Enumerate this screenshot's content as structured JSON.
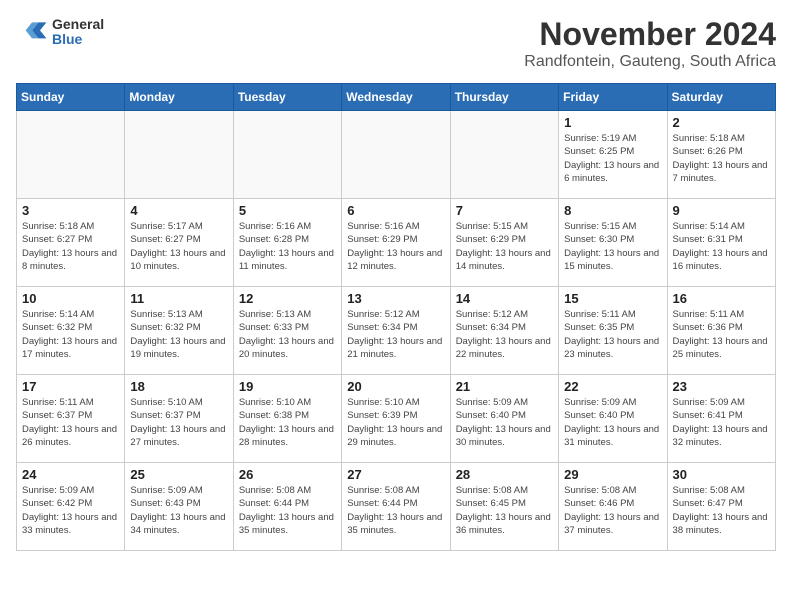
{
  "header": {
    "logo_general": "General",
    "logo_blue": "Blue",
    "month_title": "November 2024",
    "location": "Randfontein, Gauteng, South Africa"
  },
  "days_of_week": [
    "Sunday",
    "Monday",
    "Tuesday",
    "Wednesday",
    "Thursday",
    "Friday",
    "Saturday"
  ],
  "weeks": [
    [
      {
        "day": "",
        "info": ""
      },
      {
        "day": "",
        "info": ""
      },
      {
        "day": "",
        "info": ""
      },
      {
        "day": "",
        "info": ""
      },
      {
        "day": "",
        "info": ""
      },
      {
        "day": "1",
        "info": "Sunrise: 5:19 AM\nSunset: 6:25 PM\nDaylight: 13 hours and 6 minutes."
      },
      {
        "day": "2",
        "info": "Sunrise: 5:18 AM\nSunset: 6:26 PM\nDaylight: 13 hours and 7 minutes."
      }
    ],
    [
      {
        "day": "3",
        "info": "Sunrise: 5:18 AM\nSunset: 6:27 PM\nDaylight: 13 hours and 8 minutes."
      },
      {
        "day": "4",
        "info": "Sunrise: 5:17 AM\nSunset: 6:27 PM\nDaylight: 13 hours and 10 minutes."
      },
      {
        "day": "5",
        "info": "Sunrise: 5:16 AM\nSunset: 6:28 PM\nDaylight: 13 hours and 11 minutes."
      },
      {
        "day": "6",
        "info": "Sunrise: 5:16 AM\nSunset: 6:29 PM\nDaylight: 13 hours and 12 minutes."
      },
      {
        "day": "7",
        "info": "Sunrise: 5:15 AM\nSunset: 6:29 PM\nDaylight: 13 hours and 14 minutes."
      },
      {
        "day": "8",
        "info": "Sunrise: 5:15 AM\nSunset: 6:30 PM\nDaylight: 13 hours and 15 minutes."
      },
      {
        "day": "9",
        "info": "Sunrise: 5:14 AM\nSunset: 6:31 PM\nDaylight: 13 hours and 16 minutes."
      }
    ],
    [
      {
        "day": "10",
        "info": "Sunrise: 5:14 AM\nSunset: 6:32 PM\nDaylight: 13 hours and 17 minutes."
      },
      {
        "day": "11",
        "info": "Sunrise: 5:13 AM\nSunset: 6:32 PM\nDaylight: 13 hours and 19 minutes."
      },
      {
        "day": "12",
        "info": "Sunrise: 5:13 AM\nSunset: 6:33 PM\nDaylight: 13 hours and 20 minutes."
      },
      {
        "day": "13",
        "info": "Sunrise: 5:12 AM\nSunset: 6:34 PM\nDaylight: 13 hours and 21 minutes."
      },
      {
        "day": "14",
        "info": "Sunrise: 5:12 AM\nSunset: 6:34 PM\nDaylight: 13 hours and 22 minutes."
      },
      {
        "day": "15",
        "info": "Sunrise: 5:11 AM\nSunset: 6:35 PM\nDaylight: 13 hours and 23 minutes."
      },
      {
        "day": "16",
        "info": "Sunrise: 5:11 AM\nSunset: 6:36 PM\nDaylight: 13 hours and 25 minutes."
      }
    ],
    [
      {
        "day": "17",
        "info": "Sunrise: 5:11 AM\nSunset: 6:37 PM\nDaylight: 13 hours and 26 minutes."
      },
      {
        "day": "18",
        "info": "Sunrise: 5:10 AM\nSunset: 6:37 PM\nDaylight: 13 hours and 27 minutes."
      },
      {
        "day": "19",
        "info": "Sunrise: 5:10 AM\nSunset: 6:38 PM\nDaylight: 13 hours and 28 minutes."
      },
      {
        "day": "20",
        "info": "Sunrise: 5:10 AM\nSunset: 6:39 PM\nDaylight: 13 hours and 29 minutes."
      },
      {
        "day": "21",
        "info": "Sunrise: 5:09 AM\nSunset: 6:40 PM\nDaylight: 13 hours and 30 minutes."
      },
      {
        "day": "22",
        "info": "Sunrise: 5:09 AM\nSunset: 6:40 PM\nDaylight: 13 hours and 31 minutes."
      },
      {
        "day": "23",
        "info": "Sunrise: 5:09 AM\nSunset: 6:41 PM\nDaylight: 13 hours and 32 minutes."
      }
    ],
    [
      {
        "day": "24",
        "info": "Sunrise: 5:09 AM\nSunset: 6:42 PM\nDaylight: 13 hours and 33 minutes."
      },
      {
        "day": "25",
        "info": "Sunrise: 5:09 AM\nSunset: 6:43 PM\nDaylight: 13 hours and 34 minutes."
      },
      {
        "day": "26",
        "info": "Sunrise: 5:08 AM\nSunset: 6:44 PM\nDaylight: 13 hours and 35 minutes."
      },
      {
        "day": "27",
        "info": "Sunrise: 5:08 AM\nSunset: 6:44 PM\nDaylight: 13 hours and 35 minutes."
      },
      {
        "day": "28",
        "info": "Sunrise: 5:08 AM\nSunset: 6:45 PM\nDaylight: 13 hours and 36 minutes."
      },
      {
        "day": "29",
        "info": "Sunrise: 5:08 AM\nSunset: 6:46 PM\nDaylight: 13 hours and 37 minutes."
      },
      {
        "day": "30",
        "info": "Sunrise: 5:08 AM\nSunset: 6:47 PM\nDaylight: 13 hours and 38 minutes."
      }
    ]
  ]
}
